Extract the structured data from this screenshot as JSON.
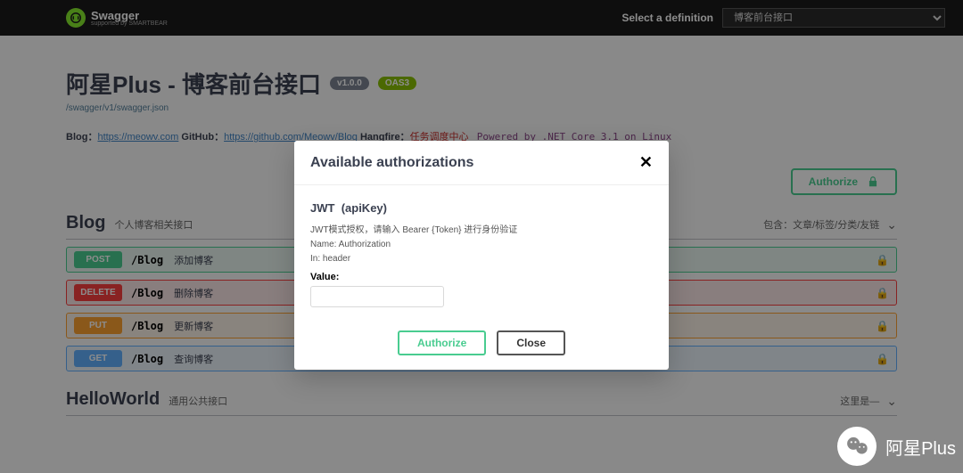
{
  "topbar": {
    "brand": "Swagger",
    "brand_sub": "supported by SMARTBEAR",
    "def_label": "Select a definition",
    "def_selected": "博客前台接口"
  },
  "header": {
    "title": "阿星Plus - 博客前台接口",
    "version": "v1.0.0",
    "oas": "OAS3",
    "spec_url": "/swagger/v1/swagger.json"
  },
  "desc": {
    "blog_label": "Blog：",
    "blog_url": "https://meowv.com",
    "github_label": " GitHub：",
    "github_url": "https://github.com/Meowv/Blog",
    "hangfire_label": " Hangfire：",
    "hangfire_link": "任务调度中心",
    "powered": "Powered by .NET Core 3.1 on Linux"
  },
  "authorize_button": "Authorize",
  "sections": [
    {
      "name": "Blog",
      "desc": "个人博客相关接口",
      "right": "包含：文章/标签/分类/友链",
      "ops": [
        {
          "method": "POST",
          "mclass": "m-post",
          "oclass": "op-post",
          "path": "/Blog",
          "desc": "添加博客"
        },
        {
          "method": "DELETE",
          "mclass": "m-del",
          "oclass": "op-del",
          "path": "/Blog",
          "desc": "删除博客"
        },
        {
          "method": "PUT",
          "mclass": "m-put",
          "oclass": "op-put",
          "path": "/Blog",
          "desc": "更新博客"
        },
        {
          "method": "GET",
          "mclass": "m-get",
          "oclass": "op-get",
          "path": "/Blog",
          "desc": "查询博客"
        }
      ]
    },
    {
      "name": "HelloWorld",
      "desc": "通用公共接口",
      "right": "这里是—",
      "ops": []
    }
  ],
  "modal": {
    "title": "Available authorizations",
    "auth_name": "JWT",
    "auth_type": "(apiKey)",
    "hint": "JWT模式授权，请输入 Bearer {Token} 进行身份验证",
    "name_label": "Name: Authorization",
    "in_label": "In: header",
    "value_label": "Value:",
    "authorize": "Authorize",
    "close": "Close"
  },
  "watermark": "阿星Plus"
}
